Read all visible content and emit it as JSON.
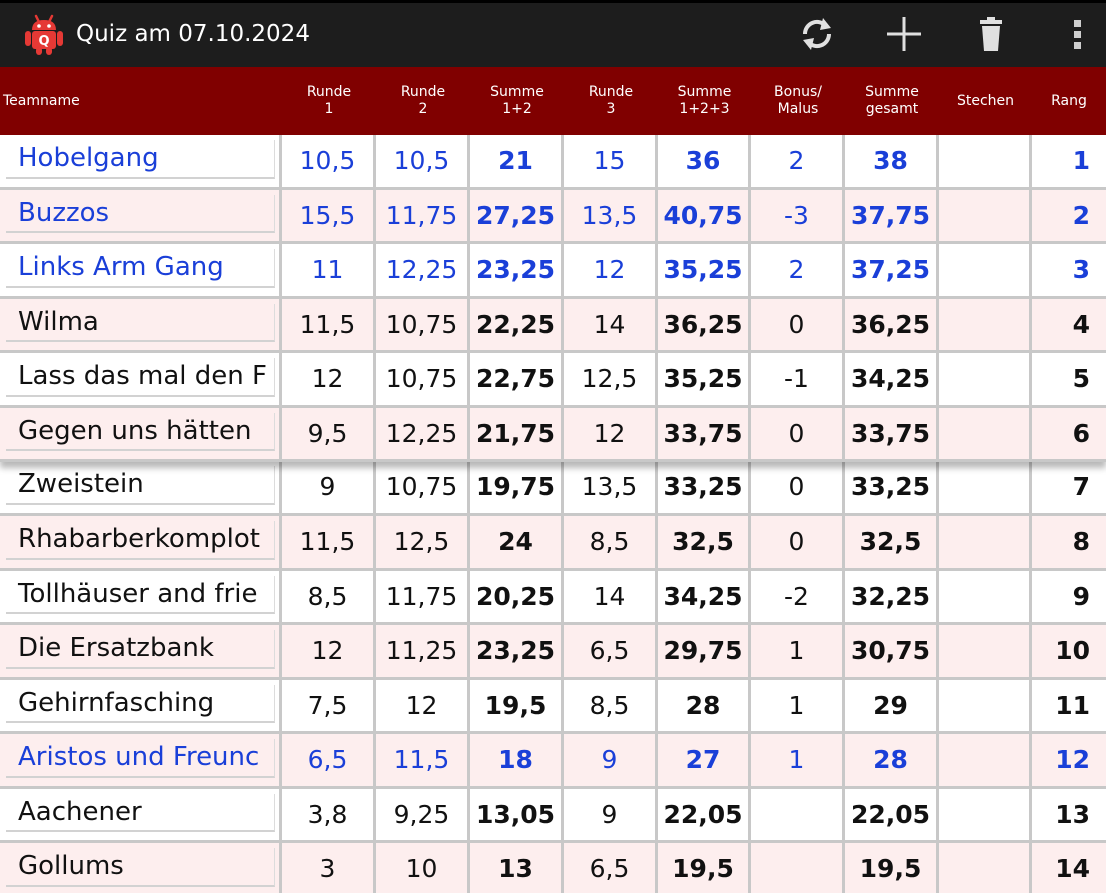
{
  "app": {
    "title": "Quiz am 07.10.2024",
    "icon_letter": "Q",
    "actions": [
      {
        "name": "refresh-icon"
      },
      {
        "name": "add-icon"
      },
      {
        "name": "trash-icon"
      },
      {
        "name": "overflow-menu-icon"
      }
    ]
  },
  "colors": {
    "action_bar": "#1d1d1d",
    "header": "#800000",
    "row_even": "#ffffff",
    "row_odd": "#fdeeee",
    "highlight_text": "#1a3fd8",
    "normal_text": "#111111"
  },
  "columns": [
    {
      "key": "team",
      "l1": "Teamname",
      "l2": ""
    },
    {
      "key": "r1",
      "l1": "Runde",
      "l2": "1"
    },
    {
      "key": "r2",
      "l1": "Runde",
      "l2": "2"
    },
    {
      "key": "s12",
      "l1": "Summe",
      "l2": "1+2"
    },
    {
      "key": "r3",
      "l1": "Runde",
      "l2": "3"
    },
    {
      "key": "s123",
      "l1": "Summe",
      "l2": "1+2+3"
    },
    {
      "key": "bonus",
      "l1": "Bonus/",
      "l2": "Malus"
    },
    {
      "key": "total",
      "l1": "Summe",
      "l2": "gesamt"
    },
    {
      "key": "stechen",
      "l1": "Stechen",
      "l2": ""
    },
    {
      "key": "rank",
      "l1": "Rang",
      "l2": ""
    }
  ],
  "rows": [
    {
      "team": "Hobelgang",
      "r1": "10,5",
      "r2": "10,5",
      "s12": "21",
      "r3": "15",
      "s123": "36",
      "bonus": "2",
      "total": "38",
      "stechen": "",
      "rank": "1",
      "highlight": true
    },
    {
      "team": "Buzzos",
      "r1": "15,5",
      "r2": "11,75",
      "s12": "27,25",
      "r3": "13,5",
      "s123": "40,75",
      "bonus": "-3",
      "total": "37,75",
      "stechen": "",
      "rank": "2",
      "highlight": true
    },
    {
      "team": "Links Arm Gang",
      "r1": "11",
      "r2": "12,25",
      "s12": "23,25",
      "r3": "12",
      "s123": "35,25",
      "bonus": "2",
      "total": "37,25",
      "stechen": "",
      "rank": "3",
      "highlight": true
    },
    {
      "team": "Wilma",
      "r1": "11,5",
      "r2": "10,75",
      "s12": "22,25",
      "r3": "14",
      "s123": "36,25",
      "bonus": "0",
      "total": "36,25",
      "stechen": "",
      "rank": "4",
      "highlight": false
    },
    {
      "team": "Lass das mal den F",
      "r1": "12",
      "r2": "10,75",
      "s12": "22,75",
      "r3": "12,5",
      "s123": "35,25",
      "bonus": "-1",
      "total": "34,25",
      "stechen": "",
      "rank": "5",
      "highlight": false
    },
    {
      "team": "Gegen uns hätten",
      "r1": "9,5",
      "r2": "12,25",
      "s12": "21,75",
      "r3": "12",
      "s123": "33,75",
      "bonus": "0",
      "total": "33,75",
      "stechen": "",
      "rank": "6",
      "highlight": false
    },
    {
      "team": "Zweistein",
      "r1": "9",
      "r2": "10,75",
      "s12": "19,75",
      "r3": "13,5",
      "s123": "33,25",
      "bonus": "0",
      "total": "33,25",
      "stechen": "",
      "rank": "7",
      "highlight": false
    },
    {
      "team": "Rhabarberkomplot",
      "r1": "11,5",
      "r2": "12,5",
      "s12": "24",
      "r3": "8,5",
      "s123": "32,5",
      "bonus": "0",
      "total": "32,5",
      "stechen": "",
      "rank": "8",
      "highlight": false
    },
    {
      "team": "Tollhäuser and frie",
      "r1": "8,5",
      "r2": "11,75",
      "s12": "20,25",
      "r3": "14",
      "s123": "34,25",
      "bonus": "-2",
      "total": "32,25",
      "stechen": "",
      "rank": "9",
      "highlight": false
    },
    {
      "team": "Die Ersatzbank",
      "r1": "12",
      "r2": "11,25",
      "s12": "23,25",
      "r3": "6,5",
      "s123": "29,75",
      "bonus": "1",
      "total": "30,75",
      "stechen": "",
      "rank": "10",
      "highlight": false
    },
    {
      "team": "Gehirnfasching",
      "r1": "7,5",
      "r2": "12",
      "s12": "19,5",
      "r3": "8,5",
      "s123": "28",
      "bonus": "1",
      "total": "29",
      "stechen": "",
      "rank": "11",
      "highlight": false
    },
    {
      "team": "Aristos und Freunc",
      "r1": "6,5",
      "r2": "11,5",
      "s12": "18",
      "r3": "9",
      "s123": "27",
      "bonus": "1",
      "total": "28",
      "stechen": "",
      "rank": "12",
      "highlight": true
    },
    {
      "team": "Aachener",
      "r1": "3,8",
      "r2": "9,25",
      "s12": "13,05",
      "r3": "9",
      "s123": "22,05",
      "bonus": "",
      "total": "22,05",
      "stechen": "",
      "rank": "13",
      "highlight": false
    },
    {
      "team": "Gollums",
      "r1": "3",
      "r2": "10",
      "s12": "13",
      "r3": "6,5",
      "s123": "19,5",
      "bonus": "",
      "total": "19,5",
      "stechen": "",
      "rank": "14",
      "highlight": false
    }
  ]
}
